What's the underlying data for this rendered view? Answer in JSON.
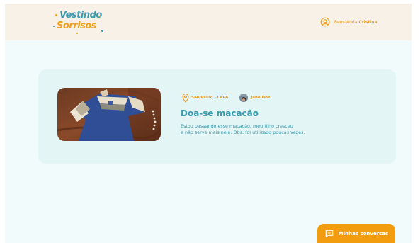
{
  "header": {
    "logo": {
      "line1": "Vestindo",
      "line2": "Sorrisos"
    },
    "greeting": {
      "prefix": "Bem-Vinda",
      "name": "Cristina"
    }
  },
  "card": {
    "location": "São Paulo - LAPA",
    "user_name": "Jane Doe",
    "title": "Doa-se macacão",
    "description_line1": "Estou passando esse macacão, meu filho cresceu",
    "description_line2": "e não serve mais nele. Obs: foi utilizado poucas vezes."
  },
  "chat_button": {
    "label": "Minhas conversas"
  },
  "icons": [
    "user-circle-icon",
    "location-pin-icon",
    "chat-icon"
  ],
  "colors": {
    "accent_orange": "#f29c10",
    "accent_teal": "#3a9bb0",
    "header_bg": "#f8f1e8",
    "page_bg": "#f1fbfc",
    "card_bg": "#e4f5f6"
  }
}
